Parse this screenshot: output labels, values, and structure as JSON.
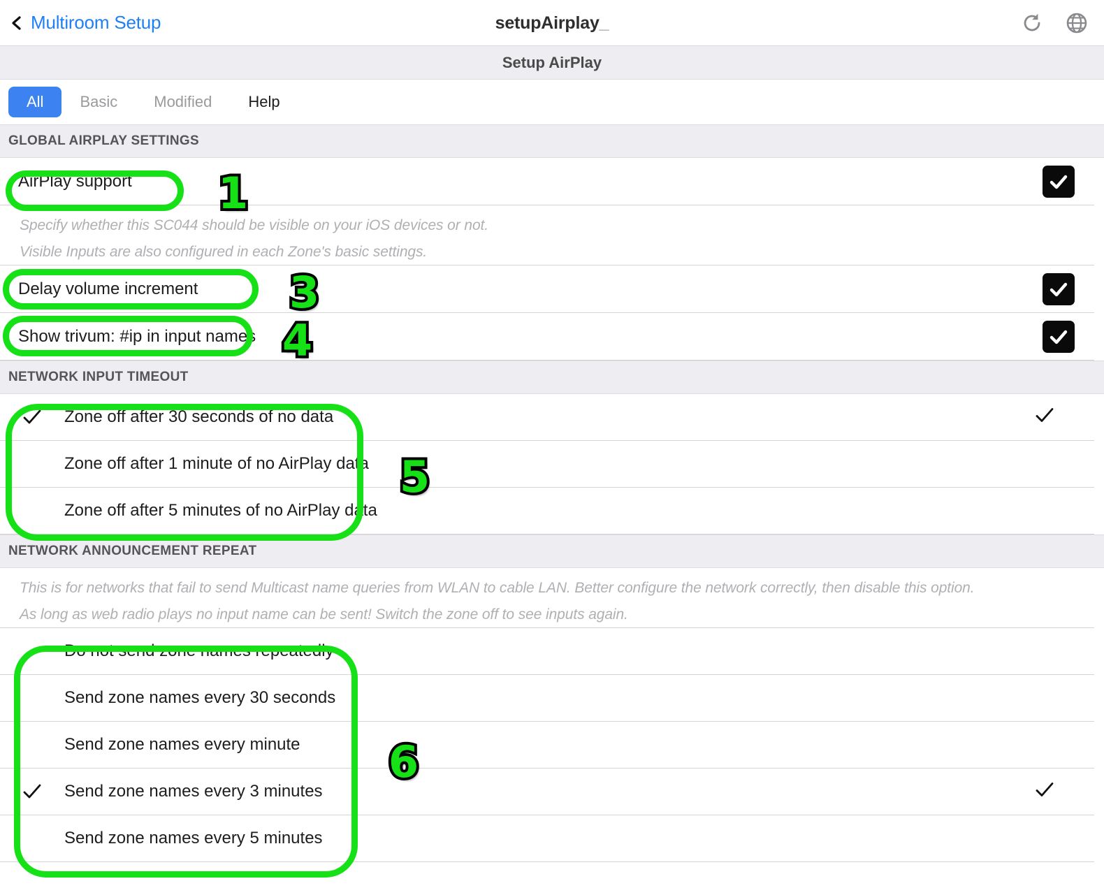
{
  "navbar": {
    "back_label": "Multiroom Setup",
    "back_icon": "chevron-left-icon",
    "title": "setupAirplay",
    "title_caret": "_",
    "actions": [
      {
        "icon": "refresh-icon",
        "name": "refresh-button"
      },
      {
        "icon": "globe-icon",
        "name": "language-button"
      }
    ]
  },
  "subtitle": {
    "text": "Setup AirPlay"
  },
  "tabs": [
    {
      "label": "All",
      "state": "active"
    },
    {
      "label": "Basic",
      "state": "muted"
    },
    {
      "label": "Modified",
      "state": "muted"
    },
    {
      "label": "Help",
      "state": "dark"
    }
  ],
  "sections": [
    {
      "header": "GLOBAL AIRPLAY SETTINGS",
      "rows": [
        {
          "type": "toggle",
          "label": "AirPlay support",
          "checked": true
        },
        {
          "type": "help",
          "label": "Specify whether this SC044 should be visible on your iOS devices or not."
        },
        {
          "type": "help",
          "label": "Visible Inputs are also configured in each Zone's basic settings."
        },
        {
          "type": "toggle",
          "label": "Delay volume increment",
          "checked": true
        },
        {
          "type": "toggle",
          "label": "Show trivum: #ip in input names",
          "checked": true
        }
      ]
    },
    {
      "header": "NETWORK INPUT TIMEOUT",
      "rows": [
        {
          "type": "option",
          "label": "Zone off after 30 seconds of no data",
          "selected": true
        },
        {
          "type": "option",
          "label": "Zone off after 1 minute of no AirPlay data",
          "selected": false
        },
        {
          "type": "option",
          "label": "Zone off after 5 minutes of no AirPlay data",
          "selected": false
        }
      ]
    },
    {
      "header": "NETWORK ANNOUNCEMENT REPEAT",
      "rows": [
        {
          "type": "help",
          "label": "This is for networks that fail to send Multicast name queries from WLAN to cable LAN. Better configure the network correctly, then disable this option."
        },
        {
          "type": "help",
          "label": "As long as web radio plays no input name can be sent! Switch the zone off to see inputs again."
        },
        {
          "type": "option",
          "label": "Do not send zone names repeatedly",
          "selected": false
        },
        {
          "type": "option",
          "label": "Send zone names every 30 seconds",
          "selected": false
        },
        {
          "type": "option",
          "label": "Send zone names every minute",
          "selected": false
        },
        {
          "type": "option",
          "label": "Send zone names every 3 minutes",
          "selected": true
        },
        {
          "type": "option",
          "label": "Send zone names every 5 minutes",
          "selected": false
        }
      ]
    }
  ],
  "annotations": {
    "color": "#16e016",
    "markers": [
      {
        "number": "1",
        "target": "AirPlay support"
      },
      {
        "number": "3",
        "target": "Delay volume increment"
      },
      {
        "number": "4",
        "target": "Show trivum: #ip in input names"
      },
      {
        "number": "5",
        "target": "Network input timeout options"
      },
      {
        "number": "6",
        "target": "Network announcement repeat options"
      }
    ]
  },
  "colors": {
    "accent_blue": "#3c82f0",
    "link_blue": "#1f7ff5",
    "band_gray": "#eeeef2",
    "divider": "#d4d4d6",
    "help_text": "#b0b0b4",
    "checkbox_fill": "#0a0a0a",
    "annotation_green": "#16e016"
  }
}
